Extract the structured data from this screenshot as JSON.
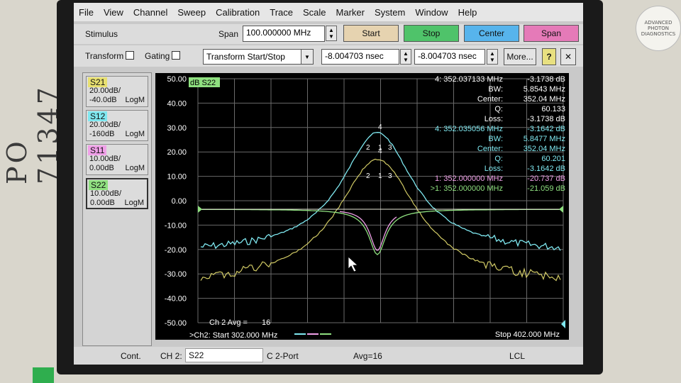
{
  "sticker": "PO 71347",
  "logo_text": "ADVANCED PHOTON DIAGNOSTICS",
  "menu": [
    "File",
    "View",
    "Channel",
    "Sweep",
    "Calibration",
    "Trace",
    "Scale",
    "Marker",
    "System",
    "Window",
    "Help"
  ],
  "stimulus": {
    "label": "Stimulus",
    "span_label": "Span",
    "span_value": "100.000000 MHz",
    "start_btn": "Start",
    "stop_btn": "Stop",
    "center_btn": "Center",
    "span_btn": "Span"
  },
  "transform": {
    "transform_label": "Transform",
    "gating_label": "Gating",
    "mode": "Transform Start/Stop",
    "start_value": "-8.004703 nsec",
    "stop_value": "-8.004703 nsec",
    "more_btn": "More...",
    "help_btn": "?",
    "close_btn": "✕"
  },
  "traces": [
    {
      "name": "S21",
      "scale": "20.00dB/",
      "ref": "-40.0dB",
      "format": "LogM",
      "color": "#e8e070"
    },
    {
      "name": "S12",
      "scale": "20.00dB/",
      "ref": "-160dB",
      "format": "LogM",
      "color": "#7fe8f0"
    },
    {
      "name": "S11",
      "scale": "10.00dB/",
      "ref": "0.00dB",
      "format": "LogM",
      "color": "#f0a0e8"
    },
    {
      "name": "S22",
      "scale": "10.00dB/",
      "ref": "0.00dB",
      "format": "LogM",
      "color": "#8fe080"
    }
  ],
  "plot": {
    "trace_label": "dB S22",
    "yticks": [
      "50.00",
      "40.00",
      "30.00",
      "20.00",
      "10.00",
      "0.00",
      "-10.00",
      "-20.00",
      "-30.00",
      "-40.00",
      "-50.00"
    ],
    "avg_text": "Ch 2 Avg =",
    "avg_value": "16",
    "start_text": ">Ch2: Start  302.000 MHz",
    "stop_text": "Stop  402.000 MHz",
    "marker_labels_cyan": [
      "4",
      "2",
      "1",
      "3"
    ],
    "marker_labels_yellow": [
      "4",
      "2",
      "1",
      "3"
    ]
  },
  "marker_readouts": {
    "white": [
      {
        "k": "4:  352.037133 MHz",
        "v": "-3.1738 dB"
      },
      {
        "k": "BW:",
        "v": "5.8543 MHz"
      },
      {
        "k": "Center:",
        "v": "352.04 MHz"
      },
      {
        "k": "Q:",
        "v": "60.133"
      },
      {
        "k": "Loss:",
        "v": "-3.1738 dB"
      }
    ],
    "cyan": [
      {
        "k": "4:  352.035056 MHz",
        "v": "-3.1642 dB"
      },
      {
        "k": "BW:",
        "v": "5.8477 MHz"
      },
      {
        "k": "Center:",
        "v": "352.04 MHz"
      },
      {
        "k": "Q:",
        "v": "60.201"
      },
      {
        "k": "Loss:",
        "v": "-3.1642 dB"
      }
    ],
    "pink": {
      "k": "1:  352.000000 MHz",
      "v": "-20.737 dB"
    },
    "green": {
      "k": ">1:  352.000000 MHz",
      "v": "-21.059 dB"
    }
  },
  "statusbar": {
    "cont": "Cont.",
    "channel": "CH 2:",
    "param": "S22",
    "c": "C  2-Port",
    "avg": "Avg=16",
    "lcl": "LCL"
  },
  "colors": {
    "s21": "#e8e070",
    "s12": "#7fe8f0",
    "s11": "#f0a0e8",
    "s22": "#8fe080",
    "start_btn": "#e6d3b0",
    "stop_btn": "#4fc36a",
    "center_btn": "#57b4ec",
    "span_btn": "#e57ab8"
  }
}
